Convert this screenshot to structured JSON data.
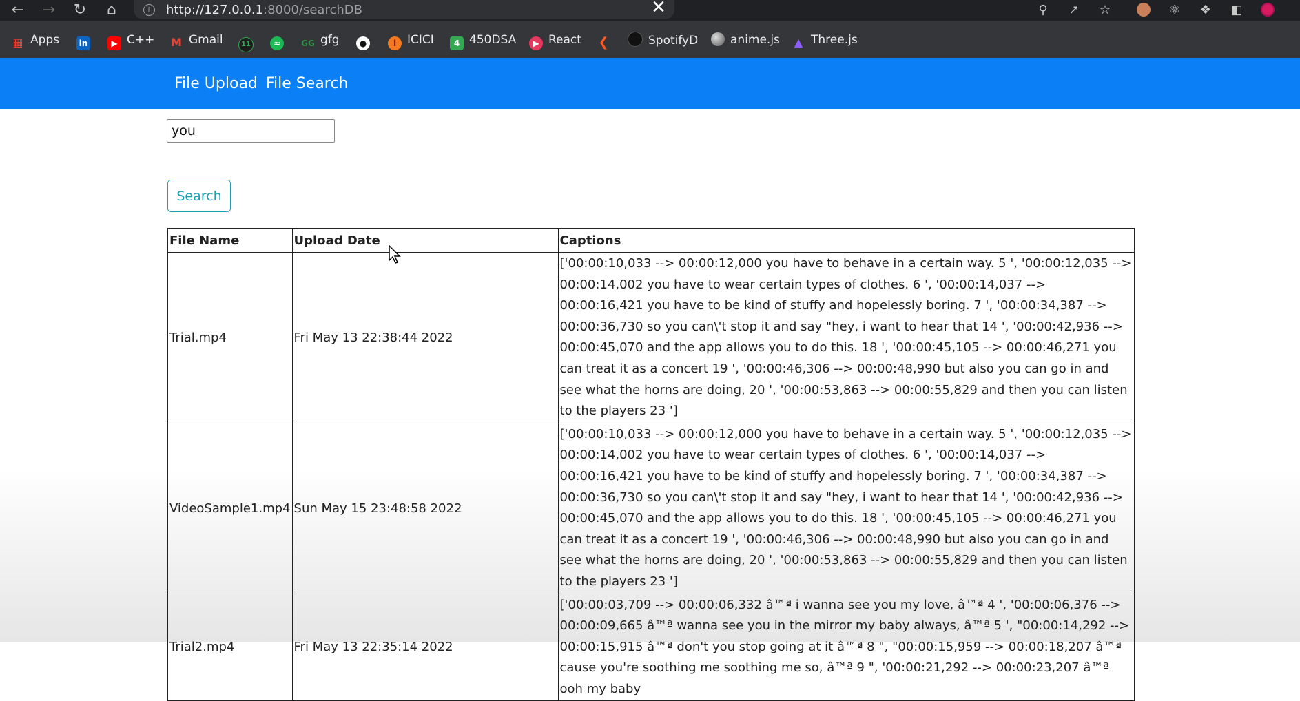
{
  "browser": {
    "url_host": "http://127.0.0.1",
    "url_rest": ":8000/searchDB",
    "bookmarks": [
      {
        "label": "Apps",
        "icon": "apps-grid-icon",
        "color": "#ea4335"
      },
      {
        "label": "",
        "icon": "linkedin-icon",
        "color": "#0a66c2"
      },
      {
        "label": "C++",
        "icon": "youtube-icon",
        "color": "#ff0000"
      },
      {
        "label": "Gmail",
        "icon": "gmail-icon",
        "color": "#ea4335"
      },
      {
        "label": "",
        "icon": "calendar-11-icon",
        "color": "#34a853"
      },
      {
        "label": "",
        "icon": "spotify-icon",
        "color": "#1db954"
      },
      {
        "label": "gfg",
        "icon": "geeksforgeeks-icon",
        "color": "#2f8d46"
      },
      {
        "label": "",
        "icon": "github-icon",
        "color": "#ffffff"
      },
      {
        "label": "ICICI",
        "icon": "icici-icon",
        "color": "#f47920"
      },
      {
        "label": "450DSA",
        "icon": "number-4-icon",
        "color": "#34a853"
      },
      {
        "label": "React",
        "icon": "react-icon",
        "color": "#e53960"
      },
      {
        "label": "",
        "icon": "codepen-icon",
        "color": "#ff5722"
      },
      {
        "label": "SpotifyD",
        "icon": "spotifyd-icon",
        "color": "#111111"
      },
      {
        "label": "anime.js",
        "icon": "animejs-icon",
        "color": "#888888"
      },
      {
        "label": "Three.js",
        "icon": "threejs-icon",
        "color": "#8b5cf6"
      }
    ]
  },
  "navbar": {
    "file_upload": "File Upload",
    "file_search": "File Search",
    "color": "#0b7ff5"
  },
  "search": {
    "value": "you",
    "button_label": "Search"
  },
  "table": {
    "headers": [
      "File Name",
      "Upload Date",
      "Captions"
    ],
    "rows": [
      {
        "file_name": "Trial.mp4",
        "upload_date": "Fri May 13 22:38:44 2022",
        "captions": "['00:00:10,033 --> 00:00:12,000 you have to behave in a certain way. 5 ', '00:00:12,035 --> 00:00:14,002 you have to wear certain types of clothes. 6 ', '00:00:14,037 --> 00:00:16,421 you have to be kind of stuffy and hopelessly boring. 7 ', '00:00:34,387 --> 00:00:36,730 so you can\\'t stop it and say \"hey, i want to hear that 14 ', '00:00:42,936 --> 00:00:45,070 and the app allows you to do this. 18 ', '00:00:45,105 --> 00:00:46,271 you can treat it as a concert 19 ', '00:00:46,306 --> 00:00:48,990 but also you can go in and see what the horns are doing, 20 ', '00:00:53,863 --> 00:00:55,829 and then you can listen to the players 23 ']"
      },
      {
        "file_name": "VideoSample1.mp4",
        "upload_date": "Sun May 15 23:48:58 2022",
        "captions": "['00:00:10,033 --> 00:00:12,000 you have to behave in a certain way. 5 ', '00:00:12,035 --> 00:00:14,002 you have to wear certain types of clothes. 6 ', '00:00:14,037 --> 00:00:16,421 you have to be kind of stuffy and hopelessly boring. 7 ', '00:00:34,387 --> 00:00:36,730 so you can\\'t stop it and say \"hey, i want to hear that 14 ', '00:00:42,936 --> 00:00:45,070 and the app allows you to do this. 18 ', '00:00:45,105 --> 00:00:46,271 you can treat it as a concert 19 ', '00:00:46,306 --> 00:00:48,990 but also you can go in and see what the horns are doing, 20 ', '00:00:53,863 --> 00:00:55,829 and then you can listen to the players 23 ']"
      },
      {
        "file_name": "Trial2.mp4",
        "upload_date": "Fri May 13 22:35:14 2022",
        "captions": "['00:00:03,709 --> 00:00:06,332 â™ª i wanna see you my love, â™ª 4 ', '00:00:06,376 --> 00:00:09,665 â™ª wanna see you in the mirror my baby always, â™ª 5 ', \"00:00:14,292 --> 00:00:15,915 â™ª don't you stop going at it â™ª 8 \", \"00:00:15,959 --> 00:00:18,207 â™ª cause you're soothing me soothing me so, â™ª 9 \", '00:00:21,292 --> 00:00:23,207 â™ª ooh my baby"
      }
    ]
  }
}
